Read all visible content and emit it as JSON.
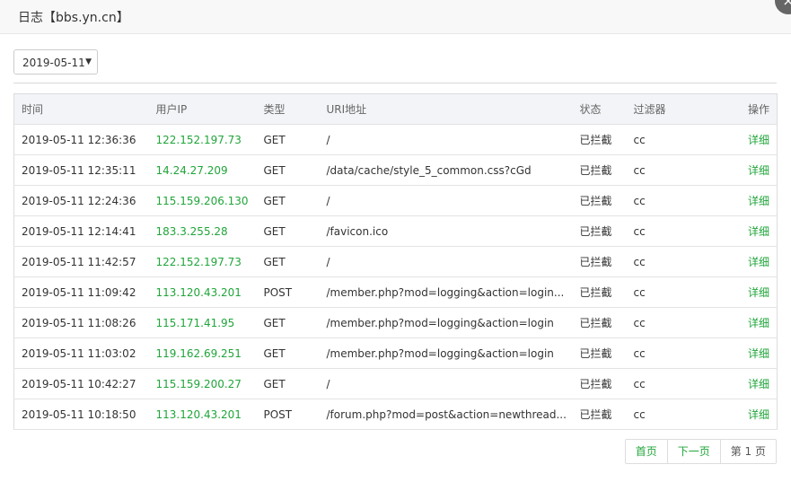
{
  "window": {
    "title": "日志【bbs.yn.cn】"
  },
  "filter": {
    "date": "2019-05-11",
    "arrow": "▼"
  },
  "table": {
    "headers": {
      "time": "时间",
      "ip": "用户IP",
      "type": "类型",
      "uri": "URI地址",
      "status": "状态",
      "filter": "过滤器",
      "action": "操作"
    },
    "rows": [
      {
        "time": "2019-05-11 12:36:36",
        "ip": "122.152.197.73",
        "type": "GET",
        "uri": "/",
        "status": "已拦截",
        "filter": "cc",
        "action": "详细"
      },
      {
        "time": "2019-05-11 12:35:11",
        "ip": "14.24.27.209",
        "type": "GET",
        "uri": "/data/cache/style_5_common.css?cGd",
        "status": "已拦截",
        "filter": "cc",
        "action": "详细"
      },
      {
        "time": "2019-05-11 12:24:36",
        "ip": "115.159.206.130",
        "type": "GET",
        "uri": "/",
        "status": "已拦截",
        "filter": "cc",
        "action": "详细"
      },
      {
        "time": "2019-05-11 12:14:41",
        "ip": "183.3.255.28",
        "type": "GET",
        "uri": "/favicon.ico",
        "status": "已拦截",
        "filter": "cc",
        "action": "详细"
      },
      {
        "time": "2019-05-11 11:42:57",
        "ip": "122.152.197.73",
        "type": "GET",
        "uri": "/",
        "status": "已拦截",
        "filter": "cc",
        "action": "详细"
      },
      {
        "time": "2019-05-11 11:09:42",
        "ip": "113.120.43.201",
        "type": "POST",
        "uri": "/member.php?mod=logging&action=login...",
        "status": "已拦截",
        "filter": "cc",
        "action": "详细"
      },
      {
        "time": "2019-05-11 11:08:26",
        "ip": "115.171.41.95",
        "type": "GET",
        "uri": "/member.php?mod=logging&action=login",
        "status": "已拦截",
        "filter": "cc",
        "action": "详细"
      },
      {
        "time": "2019-05-11 11:03:02",
        "ip": "119.162.69.251",
        "type": "GET",
        "uri": "/member.php?mod=logging&action=login",
        "status": "已拦截",
        "filter": "cc",
        "action": "详细"
      },
      {
        "time": "2019-05-11 10:42:27",
        "ip": "115.159.200.27",
        "type": "GET",
        "uri": "/",
        "status": "已拦截",
        "filter": "cc",
        "action": "详细"
      },
      {
        "time": "2019-05-11 10:18:50",
        "ip": "113.120.43.201",
        "type": "POST",
        "uri": "/forum.php?mod=post&action=newthread...",
        "status": "已拦截",
        "filter": "cc",
        "action": "详细"
      }
    ]
  },
  "pager": {
    "first": "首页",
    "next": "下一页",
    "info": "第 1 页"
  },
  "colors": {
    "accent": "#20a53a"
  },
  "icons": {
    "close": "close-icon"
  }
}
